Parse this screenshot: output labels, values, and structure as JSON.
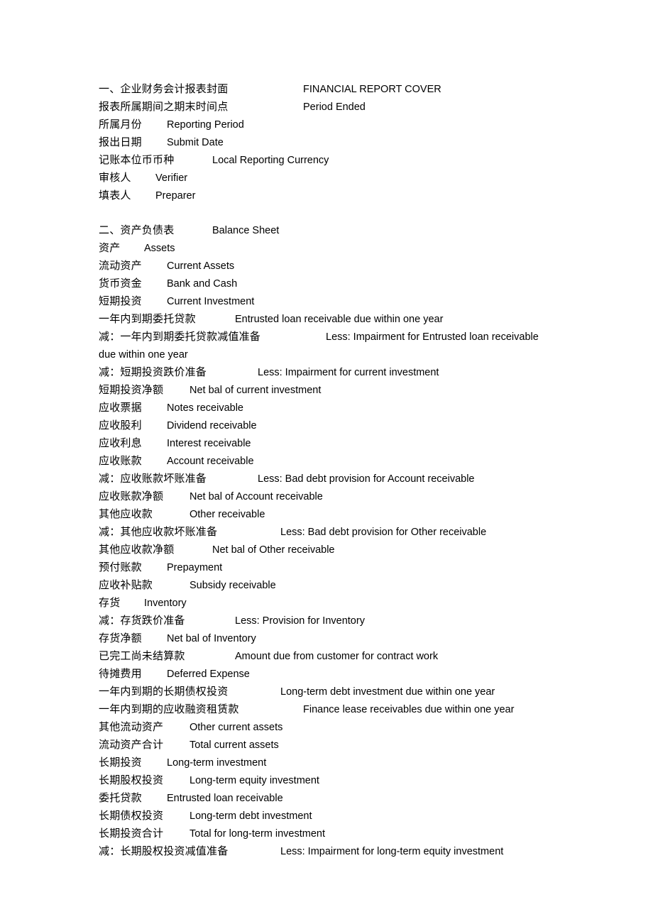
{
  "document": {
    "page_background": "#ffffff",
    "text_color": "#000000",
    "sections": [
      {
        "id": "financial-report-cover",
        "lines": [
          {
            "zh": "一、企业财务会计报表封面",
            "en": "FINANCIAL REPORT COVER",
            "tab": 288
          },
          {
            "zh": "报表所属期间之期末时间点",
            "en": "Period Ended",
            "tab": 288
          },
          {
            "zh": "所属月份",
            "en": "Reporting Period",
            "tab": 96
          },
          {
            "zh": "报出日期",
            "en": "Submit Date",
            "tab": 96
          },
          {
            "zh": "记账本位币币种",
            "en": "Local Reporting Currency",
            "tab": 160
          },
          {
            "zh": "审核人",
            "en": "Verifier",
            "tab": 80
          },
          {
            "zh": "填表人",
            "en": "Preparer",
            "tab": 80
          }
        ]
      },
      {
        "id": "balance-sheet",
        "lines": [
          {
            "zh": "二、资产负债表",
            "en": "Balance Sheet",
            "tab": 160
          },
          {
            "zh": "资产",
            "en": "Assets",
            "tab": 64
          },
          {
            "zh": "流动资产",
            "en": "Current Assets",
            "tab": 96
          },
          {
            "zh": "货币资金",
            "en": "Bank and Cash",
            "tab": 96
          },
          {
            "zh": "短期投资",
            "en": "Current Investment",
            "tab": 96
          },
          {
            "zh": "一年内到期委托贷款",
            "en": "Entrusted loan receivable due within one year",
            "tab": 192
          },
          {
            "zh": "减：一年内到期委托贷款减值准备",
            "en": "Less: Impairment for Entrusted loan receivable due within one year",
            "tab": 320
          },
          {
            "zh": "减：短期投资跌价准备",
            "en": "Less: Impairment for current investment",
            "tab": 224
          },
          {
            "zh": "短期投资净额",
            "en": "Net bal of current investment",
            "tab": 128
          },
          {
            "zh": "应收票据",
            "en": "Notes receivable",
            "tab": 96
          },
          {
            "zh": "应收股利",
            "en": "Dividend receivable",
            "tab": 96
          },
          {
            "zh": "应收利息",
            "en": "Interest receivable",
            "tab": 96
          },
          {
            "zh": "应收账款",
            "en": "Account receivable",
            "tab": 96
          },
          {
            "zh": "减：应收账款坏账准备",
            "en": "Less: Bad debt provision for Account receivable",
            "tab": 224
          },
          {
            "zh": "应收账款净额",
            "en": "Net bal of Account receivable",
            "tab": 128
          },
          {
            "zh": "其他应收款",
            "en": "Other receivable",
            "tab": 128
          },
          {
            "zh": "减：其他应收款坏账准备",
            "en": "Less: Bad debt provision for Other receivable",
            "tab": 256
          },
          {
            "zh": "其他应收款净额",
            "en": "Net bal of Other receivable",
            "tab": 160
          },
          {
            "zh": "预付账款",
            "en": "Prepayment",
            "tab": 96
          },
          {
            "zh": "应收补贴款",
            "en": "Subsidy receivable",
            "tab": 128
          },
          {
            "zh": "存货",
            "en": "Inventory",
            "tab": 64
          },
          {
            "zh": "减：存货跌价准备",
            "en": "Less: Provision for Inventory",
            "tab": 192
          },
          {
            "zh": "存货净额",
            "en": "Net bal of Inventory",
            "tab": 96
          },
          {
            "zh": "已完工尚未结算款",
            "en": "Amount due from customer for contract work",
            "tab": 192
          },
          {
            "zh": "待摊费用",
            "en": "Deferred Expense",
            "tab": 96
          },
          {
            "zh": "一年内到期的长期债权投资",
            "en": "Long-term debt investment due within one year",
            "tab": 256
          },
          {
            "zh": "一年内到期的应收融资租赁款",
            "en": "Finance lease receivables due within one year",
            "tab": 288
          },
          {
            "zh": "其他流动资产",
            "en": "Other current assets",
            "tab": 128
          },
          {
            "zh": "流动资产合计",
            "en": "Total current assets",
            "tab": 128
          },
          {
            "zh": "长期投资",
            "en": "Long-term investment",
            "tab": 96
          },
          {
            "zh": "长期股权投资",
            "en": "Long-term equity investment",
            "tab": 128
          },
          {
            "zh": "委托贷款",
            "en": "Entrusted loan receivable",
            "tab": 96
          },
          {
            "zh": "长期债权投资",
            "en": "Long-term debt investment",
            "tab": 128
          },
          {
            "zh": "长期投资合计",
            "en": "Total for long-term investment",
            "tab": 128
          },
          {
            "zh": "减：长期股权投资减值准备",
            "en": "Less: Impairment for long-term equity investment",
            "tab": 256
          }
        ]
      }
    ]
  }
}
